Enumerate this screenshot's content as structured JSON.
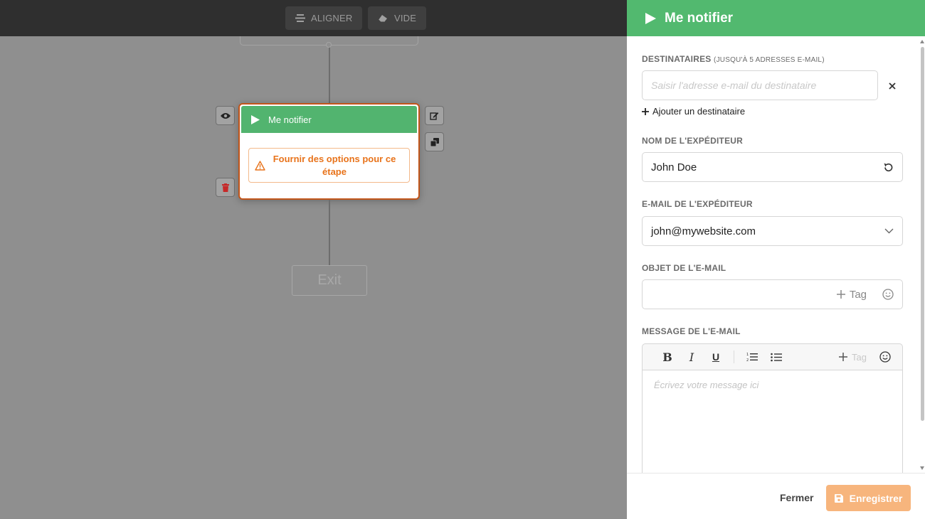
{
  "toolbar": {
    "align_label": "ALIGNER",
    "clear_label": "VIDE"
  },
  "node": {
    "title": "Me notifier",
    "warning": "Fournir des options pour ce étape"
  },
  "exit_label": "Exit",
  "panel": {
    "title": "Me notifier",
    "recipients": {
      "label": "DESTINATAIRES",
      "sublabel": "(JUSQU'À 5 ADRESSES E-MAIL)",
      "placeholder": "Saisir l'adresse e-mail du destinataire",
      "add_label": "Ajouter un destinataire"
    },
    "sender_name": {
      "label": "NOM DE L'EXPÉDITEUR",
      "value": "John Doe"
    },
    "sender_email": {
      "label": "E-MAIL DE L'EXPÉDITEUR",
      "value": "john@mywebsite.com"
    },
    "subject": {
      "label": "OBJET DE L'E-MAIL",
      "tag_label": "Tag"
    },
    "message": {
      "label": "MESSAGE DE L'E-MAIL",
      "tag_label": "Tag",
      "placeholder": "Écrivez votre message ici",
      "bold": "B",
      "italic": "I",
      "underline": "U"
    },
    "footer": {
      "close_label": "Fermer",
      "save_label": "Enregistrer"
    }
  },
  "colors": {
    "accent_green": "#52b96f",
    "node_border": "#c2551a",
    "warning_text": "#e8731b",
    "save_button": "#f7b57d"
  }
}
